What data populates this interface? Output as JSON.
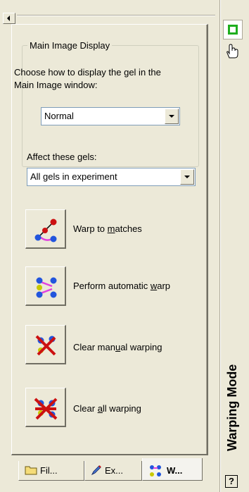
{
  "group": {
    "legend": "Main Image Display",
    "description": "Choose how to display the gel in the Main Image window:",
    "display_select": "Normal"
  },
  "affect": {
    "label": "Affect these gels:",
    "select": "All gels in experiment"
  },
  "tools": [
    {
      "label_pre": "Warp to ",
      "label_key": "m",
      "label_post": "atches",
      "icon": "warp-to-matches-icon"
    },
    {
      "label_pre": "Perform automatic ",
      "label_key": "w",
      "label_post": "arp",
      "icon": "automatic-warp-icon"
    },
    {
      "label_pre": "Clear man",
      "label_key": "u",
      "label_post": "al warping",
      "icon": "clear-manual-warping-icon"
    },
    {
      "label_pre": "Clear ",
      "label_key": "a",
      "label_post": "ll warping",
      "icon": "clear-all-warping-icon"
    }
  ],
  "tabs": [
    {
      "label": "Fil...",
      "icon": "folder-icon"
    },
    {
      "label": "Ex...",
      "icon": "pencil-icon"
    },
    {
      "label": "W...",
      "icon": "warp-tab-icon"
    }
  ],
  "sidebar": {
    "title": "Warping Mode",
    "help": "?"
  },
  "colors": {
    "face": "#ece9d8",
    "mode_green": "#1fae1f",
    "spot_blue": "#2255dd",
    "spot_red": "#cc1111",
    "link_magenta": "#e040e0"
  }
}
